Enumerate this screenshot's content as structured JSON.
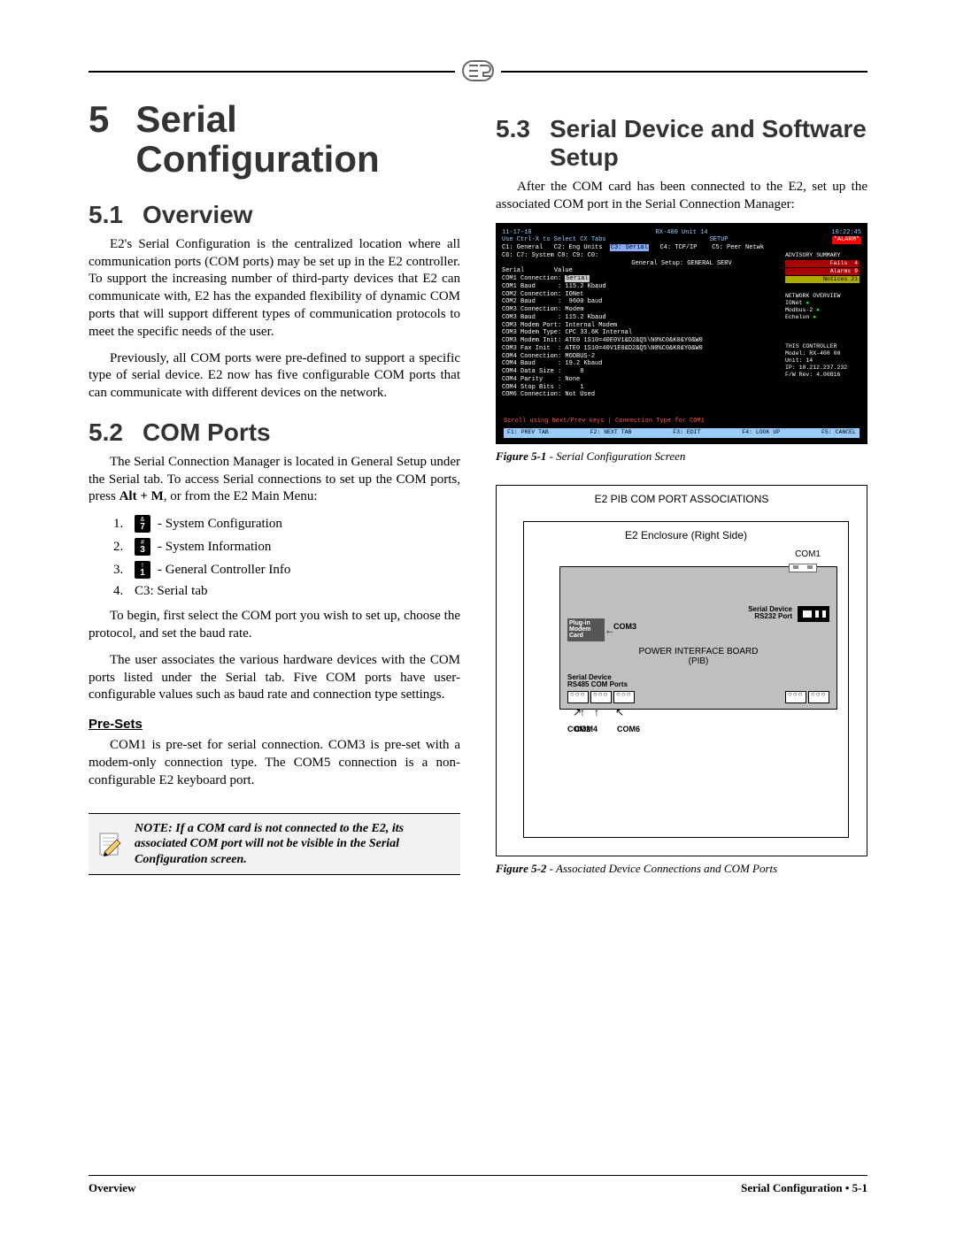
{
  "chapter": {
    "number": "5",
    "title": "Serial Configuration"
  },
  "s51": {
    "num": "5.1",
    "title": "Overview",
    "p1": "E2's Serial Configuration is the centralized location where all communication ports (COM ports) may be set up in the E2 controller. To support the increasing number of third-party devices that E2 can communicate with, E2 has the expanded flexibility of dynamic COM ports that will support different types of communication protocols to meet the specific needs of the user.",
    "p2": "Previously, all COM ports were pre-defined to support a specific type of serial device. E2 now has five configurable COM ports that can communicate with different devices on the network."
  },
  "s52": {
    "num": "5.2",
    "title": "COM Ports",
    "p1_a": "The Serial Connection Manager is located in General Setup under the Serial tab. To access Serial connections to set up the COM ports, press ",
    "p1_bold": "Alt + M",
    "p1_b": ", or from the E2 Main Menu:",
    "steps": [
      {
        "n": "1.",
        "key_top": "&",
        "key_bot": "7",
        "label": " - System Configuration"
      },
      {
        "n": "2.",
        "key_top": "#",
        "key_bot": "3",
        "label": " - System Information"
      },
      {
        "n": "3.",
        "key_top": "!",
        "key_bot": "1",
        "label": " - General Controller Info"
      },
      {
        "n": "4.",
        "key_top": "",
        "key_bot": "",
        "label": "C3: Serial tab"
      }
    ],
    "p2": "To begin, first select the COM port you wish to set up, choose the protocol, and set the baud rate.",
    "p3": "The user associates the various hardware devices with the COM ports listed under the Serial tab. Five COM ports have user-configurable values such as baud rate and connection type settings.",
    "presets_title": "Pre-Sets",
    "p4": "COM1 is pre-set for serial connection. COM3 is pre-set with a modem-only connection type. The COM5 connection is a non-configurable E2 keyboard port.",
    "note": "NOTE: If a COM card is not connected to the E2, its associated COM port will not be visible in the Serial Configuration screen."
  },
  "s53": {
    "num": "5.3",
    "title": "Serial Device and Software Setup",
    "p1": "After the COM card has been connected to the E2, set up the associated COM port in the Serial Connection Manager:"
  },
  "fig1": {
    "date": "11-17-10",
    "center": "RX-400 Unit 14",
    "time": "10:22:45",
    "hint": "Use Ctrl-X to Select CX Tabs",
    "setup": "SETUP",
    "alarm": "*ALARM*",
    "tabs": "C1: General   C2: Eng Units  C3: Serial   C4: TCP/IP    C5: Peer Netwk",
    "tabs2": "C6:           C7: System    C8:          C9:           C0:",
    "title2": "General Setup: GENERAL SERV",
    "kv": "Serial        Value\nCOM1 Connection: Serial\nCOM1 Baud      : 115.2 Kbaud\nCOM2 Connection: IONet\nCOM2 Baud      :  9600 baud\nCOM3 Connection: Modem\nCOM3 Baud      : 115.2 Kbaud\nCOM3 Modem Port: Internal Modem\nCOM3 Modem Type: CPC 33.6K Internal\nCOM3 Modem Init: ATE0 1S10=40E0V1&D2&Q5\\N0%C0&K0&Y0&W0\nCOM3 Fax Init  : ATE0 1S10=40V1E0&D2&Q5\\N0%C0&K0&Y0&W0\nCOM4 Connection: MODBUS-2\nCOM4 Baud      : 19.2 Kbaud\nCOM4 Data Size :     8\nCOM4 Parity    : None\nCOM4 Stop Bits :     1\nCOM6 Connection: Not Used",
    "adv_title": "ADVISORY SUMMARY",
    "adv": [
      {
        "k": "Fails",
        "v": "4"
      },
      {
        "k": "Alarms",
        "v": "9"
      },
      {
        "k": "Notices",
        "v": "21"
      }
    ],
    "net_title": "NETWORK OVERVIEW",
    "net": [
      "IONet",
      "Modbus-2",
      "Echelon"
    ],
    "ctl_title": "THIS CONTROLLER",
    "ctl": [
      "Model: RX-400  00",
      "Unit: 14",
      "IP: 10.212.237.232",
      "F/W Rev: 4.00B16"
    ],
    "scroll": "Scroll using Next/Prev keys | Connection Type for COM1",
    "fkeys": [
      "F1: PREV TAB",
      "F2: NEXT TAB",
      "F3: EDIT",
      "F4: LOOK UP",
      "F5: CANCEL"
    ],
    "caption_b": "Figure 5-1",
    "caption_i": " - Serial Configuration Screen"
  },
  "fig2": {
    "title": "E2 PIB COM PORT ASSOCIATIONS",
    "enclosure": "E2 Enclosure (Right Side)",
    "com1": "COM1",
    "sd": "Serial Device\nRS232 Port",
    "modem": "Plug-in\nModem\nCard",
    "com3": "COM3",
    "pib": "POWER INTERFACE BOARD\n(PIB)",
    "rs485": "Serial Device\nRS485 COM Ports",
    "com2": "COM2",
    "com6": "COM6",
    "com4": "COM4",
    "caption_b": "Figure 5-2",
    "caption_i": " - Associated Device Connections and COM Ports"
  },
  "footer": {
    "left": "Overview",
    "right": "Serial Configuration • 5-1"
  }
}
